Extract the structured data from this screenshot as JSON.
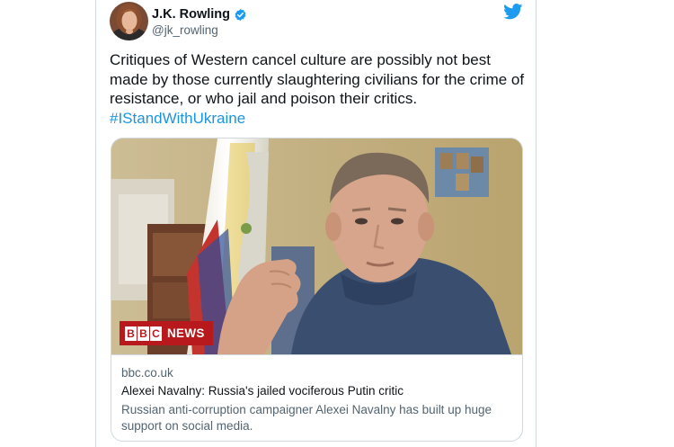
{
  "tweet": {
    "author_name": "J.K. Rowling",
    "handle": "@jk_rowling",
    "verified": true,
    "text": "Critiques of Western cancel culture are possibly not best made by those currently slaughtering civilians for the crime of resistance, or who jail and poison their critics.",
    "hashtag": "#IStandWithUkraine"
  },
  "link_card": {
    "domain": "bbc.co.uk",
    "title": "Alexei Navalny: Russia's jailed vociferous Putin critic",
    "description": "Russian anti-corruption campaigner Alexei Navalny has built up huge support on social media.",
    "overlay_letters": [
      "B",
      "B",
      "C"
    ],
    "overlay_word": "NEWS"
  },
  "icons": {
    "avatar": "avatar-photo",
    "verified": "verified-badge-icon",
    "platform": "twitter-bird-icon"
  },
  "colors": {
    "text": "#0f1419",
    "secondary_text": "#536471",
    "link": "#1b95e0",
    "border": "#cfd9de",
    "twitter_blue": "#1d9bf0",
    "bbc_red": "#b8191c"
  }
}
